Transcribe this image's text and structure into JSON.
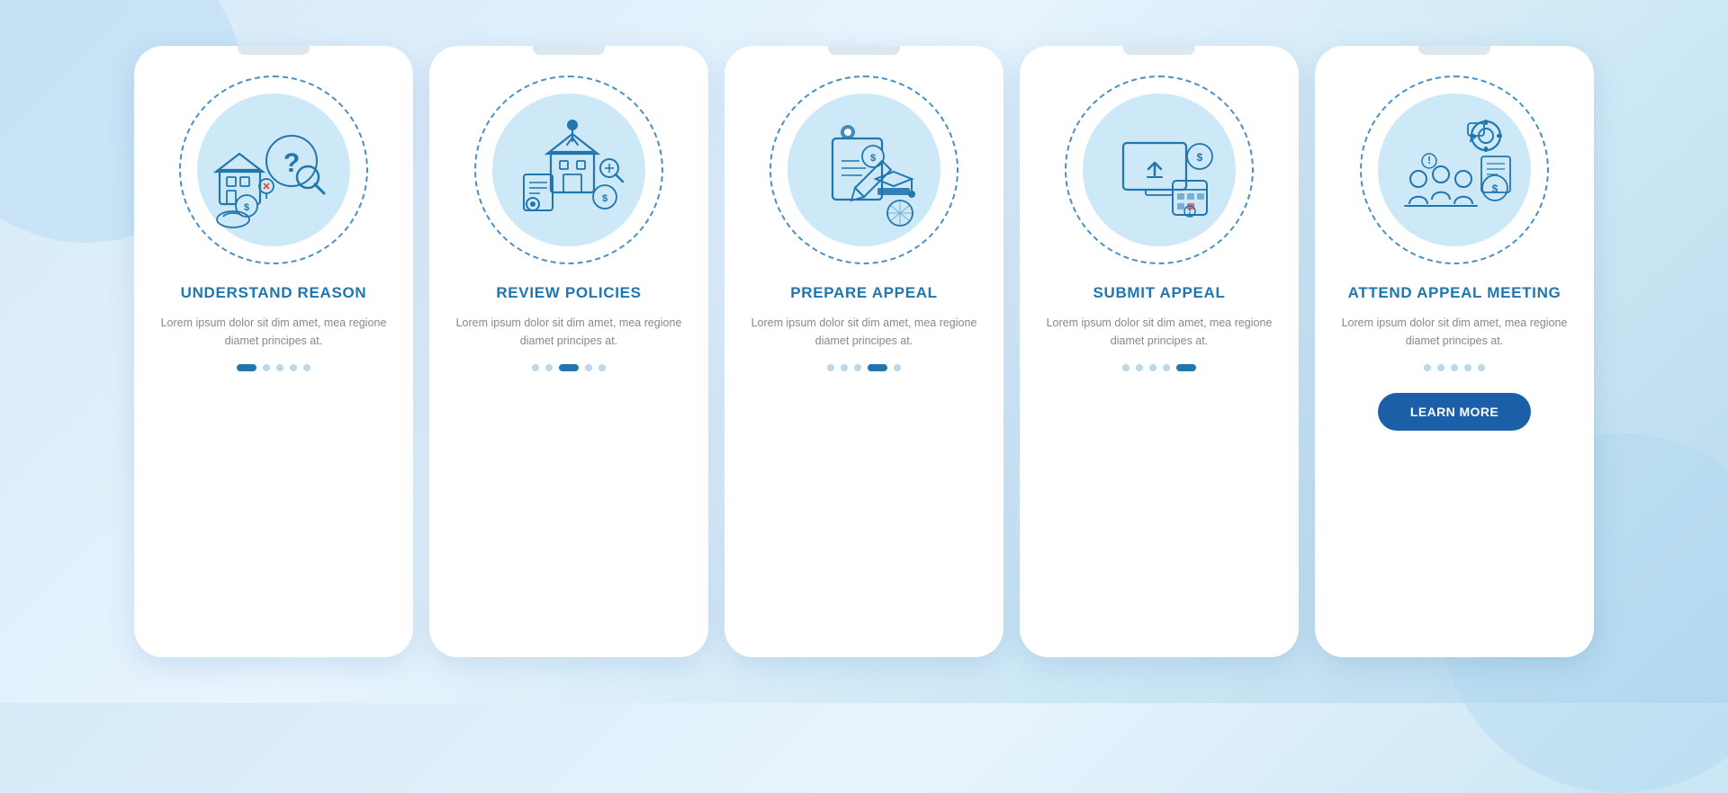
{
  "background": {
    "color_from": "#d6eaf8",
    "color_to": "#b8d9ed"
  },
  "cards": [
    {
      "id": "understand-reason",
      "title": "UNDERSTAND\nREASON",
      "description": "Lorem ipsum dolor sit dim amet, mea regione diamet principes at.",
      "dots": [
        {
          "active": true
        },
        {
          "active": false
        },
        {
          "active": false
        },
        {
          "active": false
        },
        {
          "active": false
        }
      ],
      "show_button": false
    },
    {
      "id": "review-policies",
      "title": "REVIEW POLICIES",
      "description": "Lorem ipsum dolor sit dim amet, mea regione diamet principes at.",
      "dots": [
        {
          "active": false
        },
        {
          "active": false
        },
        {
          "active": true
        },
        {
          "active": false
        },
        {
          "active": false
        }
      ],
      "show_button": false
    },
    {
      "id": "prepare-appeal",
      "title": "PREPARE APPEAL",
      "description": "Lorem ipsum dolor sit dim amet, mea regione diamet principes at.",
      "dots": [
        {
          "active": false
        },
        {
          "active": false
        },
        {
          "active": false
        },
        {
          "active": true
        },
        {
          "active": false
        }
      ],
      "show_button": false
    },
    {
      "id": "submit-appeal",
      "title": "SUBMIT APPEAL",
      "description": "Lorem ipsum dolor sit dim amet, mea regione diamet principes at.",
      "dots": [
        {
          "active": false
        },
        {
          "active": false
        },
        {
          "active": false
        },
        {
          "active": false
        },
        {
          "active": true
        }
      ],
      "show_button": false
    },
    {
      "id": "attend-appeal-meeting",
      "title": "ATTEND APPEAL\nMEETING",
      "description": "Lorem ipsum dolor sit dim amet, mea regione diamet principes at.",
      "dots": [
        {
          "active": false
        },
        {
          "active": false
        },
        {
          "active": false
        },
        {
          "active": false
        },
        {
          "active": false
        }
      ],
      "show_button": true,
      "button_label": "LEARN MORE"
    }
  ]
}
